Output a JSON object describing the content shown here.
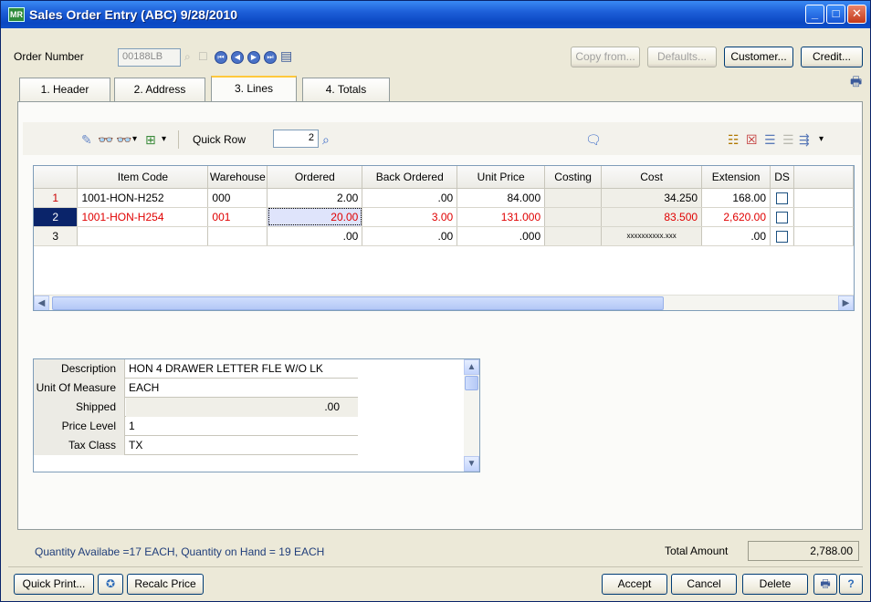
{
  "window": {
    "title": "Sales Order Entry (ABC) 9/28/2010",
    "app_icon_text": "MR"
  },
  "header": {
    "order_number_label": "Order Number",
    "order_number": "00188LB",
    "buttons": {
      "copy_from": "Copy from...",
      "defaults": "Defaults...",
      "customer": "Customer...",
      "credit": "Credit..."
    }
  },
  "tabs": [
    {
      "label": "1. Header"
    },
    {
      "label": "2. Address"
    },
    {
      "label": "3. Lines"
    },
    {
      "label": "4. Totals"
    }
  ],
  "toolbar": {
    "quick_row_label": "Quick Row",
    "quick_row_value": "2"
  },
  "grid": {
    "columns": [
      "",
      "Item Code",
      "Warehouse",
      "Ordered",
      "Back Ordered",
      "Unit Price",
      "Costing",
      "Cost",
      "Extension",
      "DS"
    ],
    "rows": [
      {
        "num": "1",
        "item": "1001-HON-H252",
        "wh": "000",
        "ordered": "2.00",
        "back": ".00",
        "price": "84.000",
        "costing": "",
        "cost": "34.250",
        "ext": "168.00"
      },
      {
        "num": "2",
        "item": "1001-HON-H254",
        "wh": "001",
        "ordered": "20.00",
        "back": "3.00",
        "price": "131.000",
        "costing": "",
        "cost": "83.500",
        "ext": "2,620.00"
      },
      {
        "num": "3",
        "item": "",
        "wh": "",
        "ordered": ".00",
        "back": ".00",
        "price": ".000",
        "costing": "",
        "cost": "xxxxxxxxxx.xxx",
        "ext": ".00"
      }
    ]
  },
  "detail": {
    "rows": [
      {
        "label": "Description",
        "value": "HON 4 DRAWER LETTER FLE W/O LK"
      },
      {
        "label": "Unit Of Measure",
        "value": "EACH"
      },
      {
        "label": "Shipped",
        "value": ".00"
      },
      {
        "label": "Price Level",
        "value": "1"
      },
      {
        "label": "Tax Class",
        "value": "TX"
      }
    ]
  },
  "status": {
    "quantity_text": "Quantity Availabe =17 EACH, Quantity on Hand = 19 EACH",
    "total_label": "Total Amount",
    "total_value": "2,788.00"
  },
  "footer": {
    "quick_print": "Quick Print...",
    "recalc_price": "Recalc Price",
    "accept": "Accept",
    "cancel": "Cancel",
    "delete": "Delete"
  },
  "colors": {
    "title_bar": "#0a47c2",
    "selected_row_text": "#e00000",
    "window_bg": "#ece9d8"
  }
}
